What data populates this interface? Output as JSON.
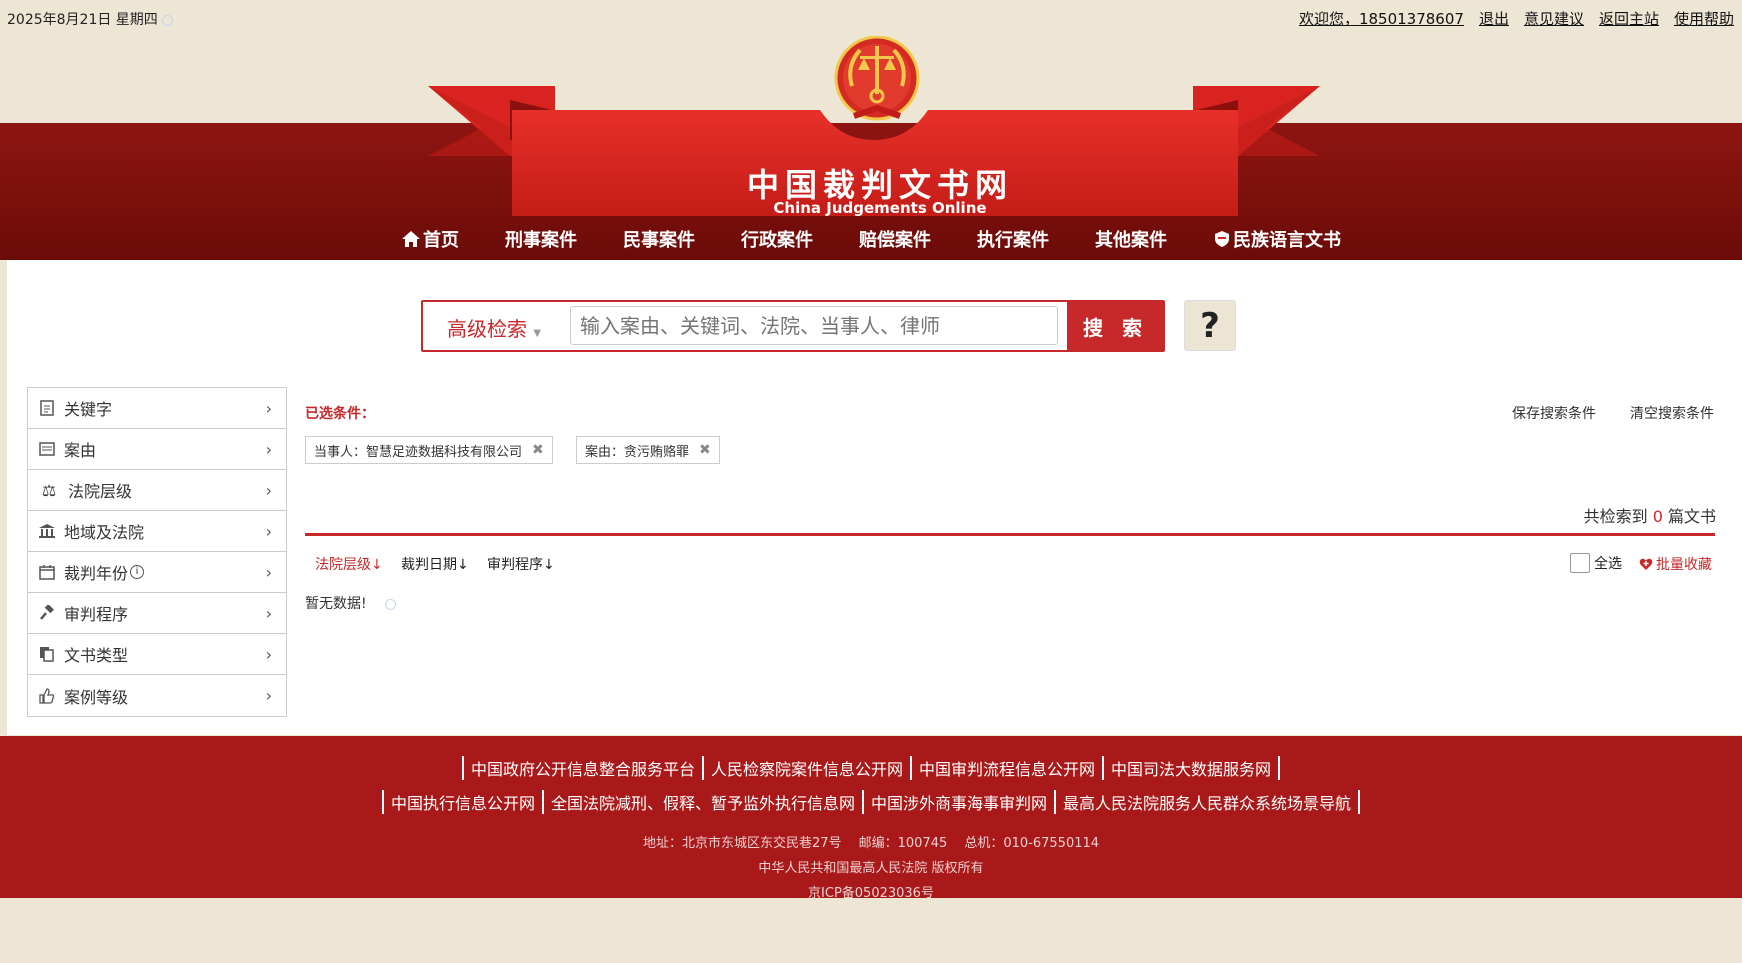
{
  "top": {
    "date": "2025年8月21日 星期四",
    "links": [
      "欢迎您，18501378607",
      "退出",
      "意见建议",
      "返回主站",
      "使用帮助"
    ]
  },
  "brand": {
    "cn_title": "中国裁判文书网",
    "en_title": "China Judgements Online",
    "colors": {
      "red": "#c7282a",
      "dark_red": "#7a0f0c",
      "cream": "#ede6d4"
    }
  },
  "nav": [
    {
      "label": "首页",
      "icon": "home-icon"
    },
    {
      "label": "刑事案件"
    },
    {
      "label": "民事案件"
    },
    {
      "label": "行政案件"
    },
    {
      "label": "赔偿案件"
    },
    {
      "label": "执行案件"
    },
    {
      "label": "其他案件"
    },
    {
      "label": "民族语言文书",
      "icon": "shield-icon"
    }
  ],
  "search": {
    "advanced_label": "高级检索",
    "placeholder": "输入案由、关键词、法院、当事人、律师",
    "button": "搜 索",
    "help": "?"
  },
  "sidebar": {
    "items": [
      {
        "label": "关键字",
        "icon": "document-icon"
      },
      {
        "label": "案由",
        "icon": "list-card-icon"
      },
      {
        "label": "法院层级",
        "icon": "scales-icon"
      },
      {
        "label": "地域及法院",
        "icon": "courthouse-icon"
      },
      {
        "label": "裁判年份",
        "icon": "calendar-icon"
      },
      {
        "label": "审判程序",
        "icon": "gavel-icon"
      },
      {
        "label": "文书类型",
        "icon": "files-icon"
      },
      {
        "label": "案例等级",
        "icon": "thumbs-up-icon"
      }
    ]
  },
  "filters": {
    "selected_label": "已选条件：",
    "save": "保存搜索条件",
    "clear": "清空搜索条件",
    "tags": [
      "当事人：智慧足迹数据科技有限公司",
      "案由：贪污贿赂罪"
    ]
  },
  "results": {
    "total_prefix": "共检索到",
    "total": "0",
    "total_suffix": "篇文书",
    "sorts": [
      "法院层级",
      "裁判日期",
      "审判程序"
    ],
    "select_all": "全选",
    "batch_collect": "批量收藏",
    "empty": "暂无数据!"
  },
  "footer": {
    "links_row1": [
      "中国政府公开信息整合服务平台",
      "人民检察院案件信息公开网",
      "中国审判流程信息公开网",
      "中国司法大数据服务网"
    ],
    "links_row2": [
      "中国执行信息公开网",
      "全国法院减刑、假释、暂予监外执行信息网",
      "中国涉外商事海事审判网",
      "最高人民法院服务人民群众系统场景导航"
    ],
    "address": "地址：北京市东城区东交民巷27号　 邮编：100745　 总机：010-67550114",
    "copyright": "中华人民共和国最高人民法院 版权所有",
    "icp": "京ICP备05023036号"
  }
}
